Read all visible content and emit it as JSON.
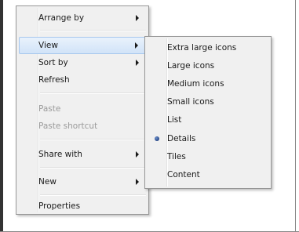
{
  "context_menu": {
    "items": [
      {
        "label": "Arrange by",
        "has_submenu": true
      },
      {
        "label": "View",
        "has_submenu": true,
        "highlighted": true
      },
      {
        "label": "Sort by",
        "has_submenu": true
      },
      {
        "label": "Refresh"
      },
      {
        "label": "Paste",
        "disabled": true
      },
      {
        "label": "Paste shortcut",
        "disabled": true
      },
      {
        "label": "Share with",
        "has_submenu": true
      },
      {
        "label": "New",
        "has_submenu": true
      },
      {
        "label": "Properties"
      }
    ]
  },
  "view_submenu": {
    "items": [
      {
        "label": "Extra large icons"
      },
      {
        "label": "Large icons"
      },
      {
        "label": "Medium icons"
      },
      {
        "label": "Small icons"
      },
      {
        "label": "List"
      },
      {
        "label": "Details",
        "selected": true
      },
      {
        "label": "Tiles"
      },
      {
        "label": "Content"
      }
    ]
  },
  "colors": {
    "menu_background": "#f0f0f0",
    "menu_border": "#979797",
    "highlight": "#d1e3f8",
    "highlight_border": "#a8c8ee",
    "disabled_text": "#9a9a9a"
  }
}
